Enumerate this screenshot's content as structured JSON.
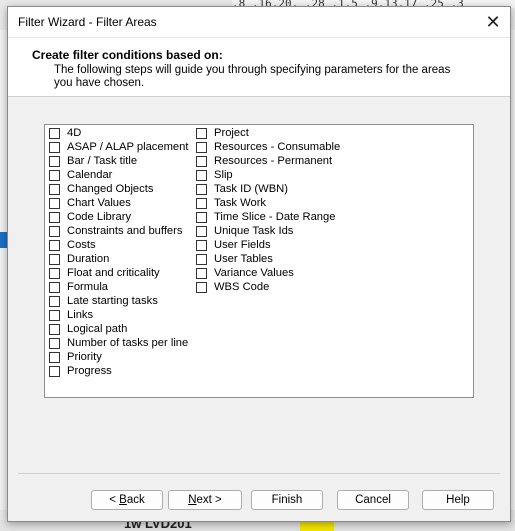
{
  "dialog": {
    "title": "Filter Wizard - Filter Areas",
    "header_title": "Create filter conditions based on:",
    "header_desc": "The following steps will guide you through specifying parameters for the areas you have chosen."
  },
  "areas_col1": [
    {
      "label": "4D",
      "checked": false
    },
    {
      "label": "ASAP / ALAP placement",
      "checked": false
    },
    {
      "label": "Bar / Task title",
      "checked": false
    },
    {
      "label": "Calendar",
      "checked": false
    },
    {
      "label": "Changed Objects",
      "checked": false
    },
    {
      "label": "Chart Values",
      "checked": false
    },
    {
      "label": "Code Library",
      "checked": false
    },
    {
      "label": "Constraints and buffers",
      "checked": false
    },
    {
      "label": "Costs",
      "checked": false
    },
    {
      "label": "Duration",
      "checked": false
    },
    {
      "label": "Float and criticality",
      "checked": false
    },
    {
      "label": "Formula",
      "checked": false
    },
    {
      "label": "Late starting tasks",
      "checked": false
    },
    {
      "label": "Links",
      "checked": false
    },
    {
      "label": "Logical path",
      "checked": false
    },
    {
      "label": "Number of tasks per line",
      "checked": false
    },
    {
      "label": "Priority",
      "checked": false
    },
    {
      "label": "Progress",
      "checked": false
    }
  ],
  "areas_col2": [
    {
      "label": "Project",
      "checked": false
    },
    {
      "label": "Resources - Consumable",
      "checked": false
    },
    {
      "label": "Resources - Permanent",
      "checked": false
    },
    {
      "label": "Slip",
      "checked": false
    },
    {
      "label": "Task ID (WBN)",
      "checked": false
    },
    {
      "label": "Task Work",
      "checked": false
    },
    {
      "label": "Time Slice - Date Range",
      "checked": false
    },
    {
      "label": "Unique Task Ids",
      "checked": false
    },
    {
      "label": "User Fields",
      "checked": false
    },
    {
      "label": "User Tables",
      "checked": false
    },
    {
      "label": "Variance Values",
      "checked": false
    },
    {
      "label": "WBS Code",
      "checked": false
    }
  ],
  "buttons": {
    "back_mnemonic": "B",
    "back_rest": "ack",
    "back_prefix": "< ",
    "next_mnemonic": "N",
    "next_rest": "ext >",
    "finish": "Finish",
    "cancel": "Cancel",
    "help": "Help"
  },
  "background": {
    "ruler_text": ",8    ,16,20,  ,28 ,1,5   ,9,13,17  ,25   ,3",
    "bottom_text": "1w   LVD201"
  }
}
